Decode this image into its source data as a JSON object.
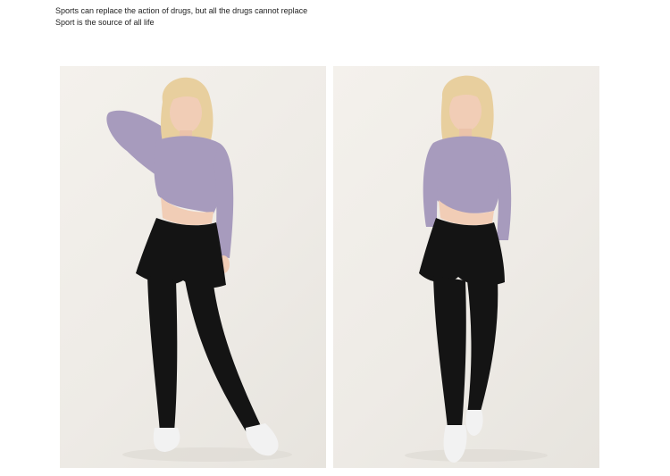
{
  "caption": {
    "line1": "Sports can replace the action of drugs, but all the drugs cannot replace",
    "line2": "Sport is the source of all life"
  },
  "colors": {
    "background": "#ffffff",
    "photo_background": "#f1eee9",
    "top": "#a79bbd",
    "shorts_leggings": "#141414",
    "hair": "#e8cf9e",
    "skin": "#f1cdb6",
    "shoes": "#f2f2f2"
  },
  "photos": [
    {
      "name": "model-photo-left",
      "subject": "model in lavender long-sleeve top and black shorts over leggings"
    },
    {
      "name": "model-photo-right",
      "subject": "model in lavender long-sleeve top and black shorts over leggings, front view"
    }
  ]
}
